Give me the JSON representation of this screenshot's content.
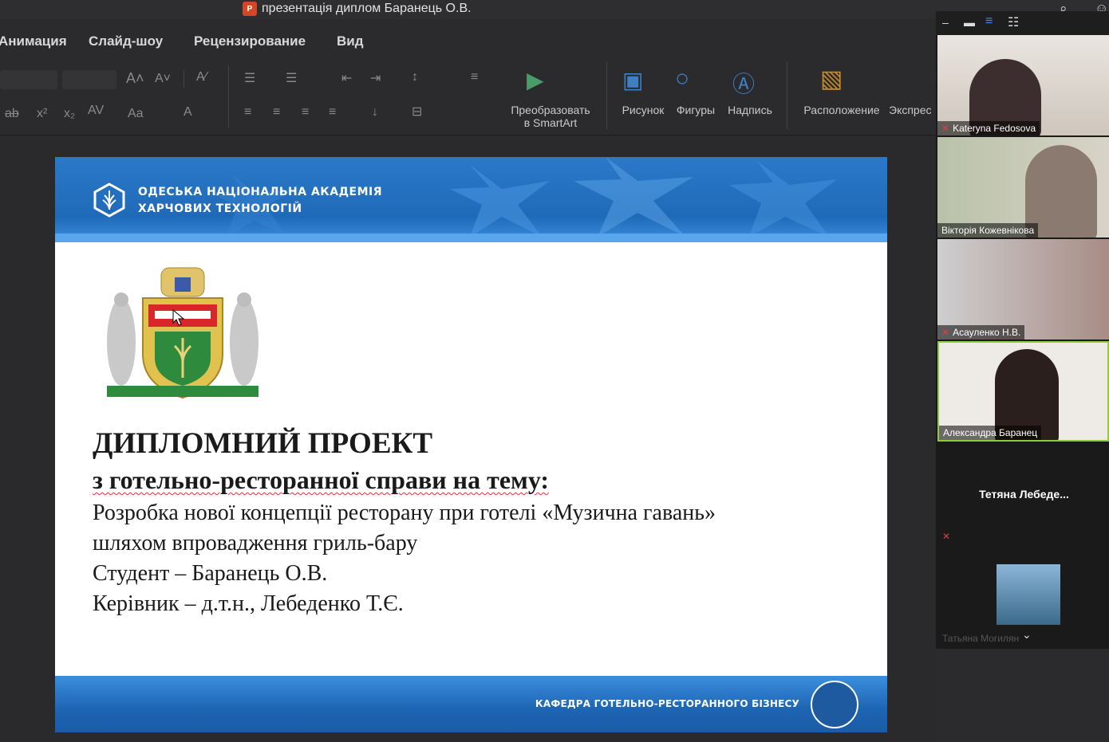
{
  "window": {
    "title": "презентація диплом Баранець О.В."
  },
  "menu": [
    "Анимация",
    "Слайд-шоу",
    "Рецензирование",
    "Вид"
  ],
  "ribbon": {
    "smartart": "Преобразовать\nв SmartArt",
    "picture": "Рисунок",
    "shapes": "Фигуры",
    "textbox": "Надпись",
    "arrange": "Расположение",
    "express": "Экспрес"
  },
  "slide": {
    "header_line1": "ОДЕСЬКА НАЦІОНАЛЬНА АКАДЕМІЯ",
    "header_line2": "ХАРЧОВИХ ТЕХНОЛОГІЙ",
    "title": "ДИПЛОМНИЙ ПРОЕКТ",
    "subtitle": "з готельно-ресторанної справи на тему:",
    "topic_line1": "Розробка нової концепції ресторану при готелі «Музична гавань»",
    "topic_line2": "шляхом впровадження гриль-бару",
    "student": "Студент – Баранець О.В.",
    "supervisor": "Керівник – д.т.н., Лебеденко Т.Є.",
    "footer": "КАФЕДРА ГОТЕЛЬНО-РЕСТОРАННОГО БІЗНЕСУ"
  },
  "participants": [
    {
      "name": "Kateryna Fedosova",
      "muted": true
    },
    {
      "name": "Вікторія Кожевнікова",
      "muted": false
    },
    {
      "name": "Асауленко Н.В.",
      "muted": true
    },
    {
      "name": "Александра Баранец",
      "muted": false,
      "active": true
    },
    {
      "name": "Тетяна  Лебеде...",
      "muted": true,
      "video": false
    },
    {
      "name": "Татьяна Могилян",
      "muted": true,
      "video": false
    }
  ]
}
